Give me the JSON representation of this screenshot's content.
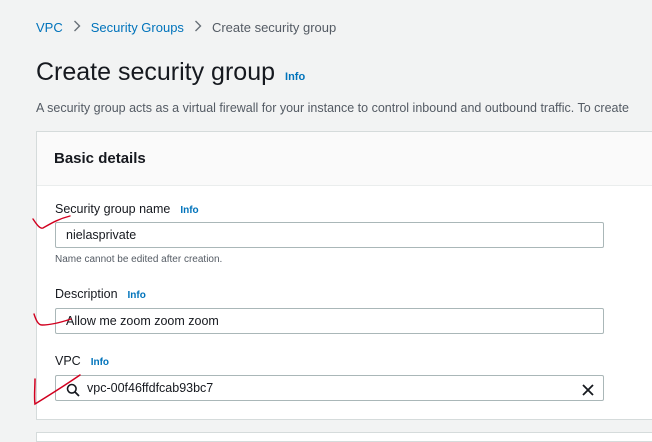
{
  "breadcrumb": {
    "items": [
      "VPC",
      "Security Groups"
    ],
    "current": "Create security group"
  },
  "page": {
    "title": "Create security group",
    "info_label": "Info",
    "subtitle": "A security group acts as a virtual firewall for your instance to control inbound and outbound traffic. To create"
  },
  "basic_details": {
    "heading": "Basic details",
    "name_field": {
      "label": "Security group name",
      "info_label": "Info",
      "value": "nielasprivate",
      "hint": "Name cannot be edited after creation."
    },
    "description_field": {
      "label": "Description",
      "info_label": "Info",
      "value": "Allow me zoom zoom zoom"
    },
    "vpc_field": {
      "label": "VPC",
      "info_label": "Info",
      "value": "vpc-00f46ffdfcab93bc7"
    }
  },
  "icons": {
    "breadcrumb_separator": "chevron-right-icon",
    "vpc_search": "search-icon",
    "vpc_clear": "close-icon"
  },
  "colors": {
    "link": "#0073bb",
    "annotation": "#d1001f"
  }
}
